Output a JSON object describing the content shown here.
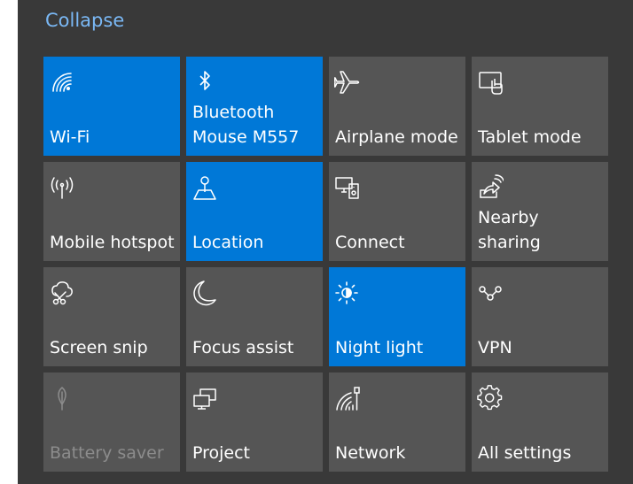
{
  "header": {
    "collapse_label": "Collapse"
  },
  "tiles": [
    {
      "label": "Wi-Fi",
      "icon": "wifi-icon",
      "state": "on"
    },
    {
      "label": "Bluetooth\nMouse M557",
      "icon": "bluetooth-icon",
      "state": "on"
    },
    {
      "label": "Airplane mode",
      "icon": "airplane-icon",
      "state": "off"
    },
    {
      "label": "Tablet mode",
      "icon": "tablet-mode-icon",
      "state": "off"
    },
    {
      "label": "Mobile hotspot",
      "icon": "mobile-hotspot-icon",
      "state": "off"
    },
    {
      "label": "Location",
      "icon": "location-icon",
      "state": "on"
    },
    {
      "label": "Connect",
      "icon": "connect-icon",
      "state": "off"
    },
    {
      "label": "Nearby sharing",
      "icon": "nearby-sharing-icon",
      "state": "off"
    },
    {
      "label": "Screen snip",
      "icon": "screen-snip-icon",
      "state": "off"
    },
    {
      "label": "Focus assist",
      "icon": "focus-assist-moon-icon",
      "state": "off"
    },
    {
      "label": "Night light",
      "icon": "night-light-sun-icon",
      "state": "on"
    },
    {
      "label": "VPN",
      "icon": "vpn-icon",
      "state": "off"
    },
    {
      "label": "Battery saver",
      "icon": "battery-saver-leaf-icon",
      "state": "disabled"
    },
    {
      "label": "Project",
      "icon": "project-icon",
      "state": "off"
    },
    {
      "label": "Network",
      "icon": "network-icon",
      "state": "off"
    },
    {
      "label": "All settings",
      "icon": "gear-icon",
      "state": "off"
    }
  ],
  "colors": {
    "panel_bg": "#393939",
    "tile_off": "#555555",
    "tile_on": "#0078d7",
    "link": "#7ab8f5",
    "text": "#ffffff",
    "text_disabled": "#8c8c8c"
  }
}
